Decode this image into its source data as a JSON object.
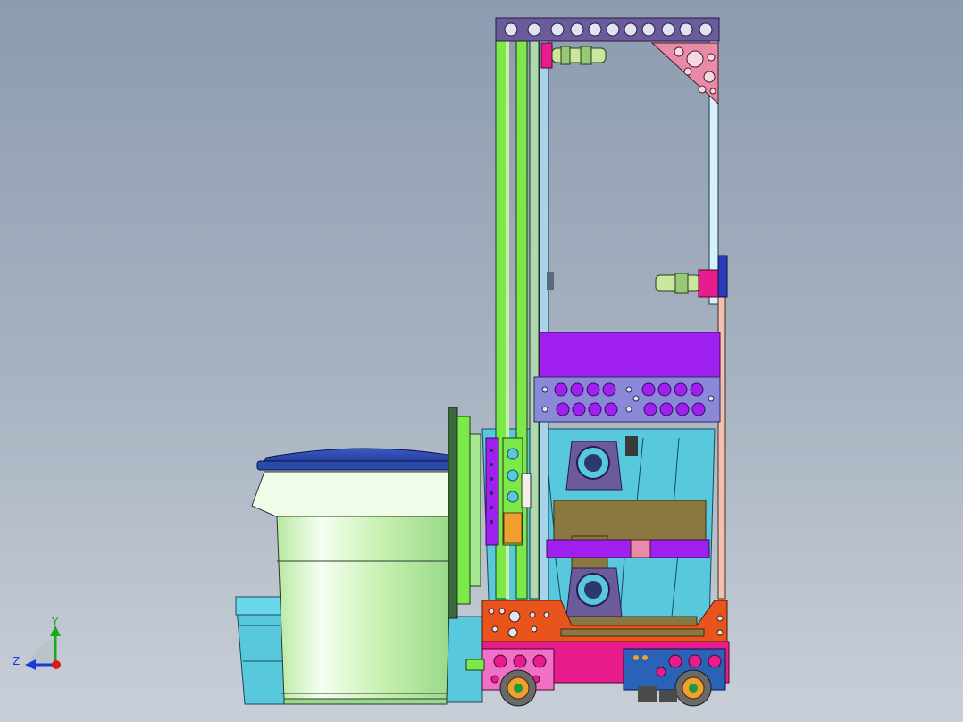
{
  "viewport": {
    "background_top": "#8c9bb0",
    "background_bottom": "#c9cfd8"
  },
  "model": {
    "colors": {
      "frame_green": "#7de84a",
      "frame_light_blue": "#a8d4ea",
      "top_bar_purple": "#6b5b9a",
      "gusset_pink": "#e88aa8",
      "lift_purple": "#a020f0",
      "lift_plate": "#8a88d8",
      "tote_cyan": "#58c8dc",
      "bin_green": "#c8f0b0",
      "bin_lid": "#2a4aa8",
      "base_orange": "#e8541c",
      "base_magenta": "#e81c8c",
      "base_pink_plate": "#f070c8",
      "side_plate_blue": "#2a62b8",
      "olive": "#8a7840",
      "latch_green": "#c8e8a0"
    }
  },
  "triad": {
    "y_label": "Y",
    "z_label": "Z",
    "y_color": "#1aa81a",
    "z_color": "#1a3ad8",
    "x_color": "#d81a1a"
  }
}
